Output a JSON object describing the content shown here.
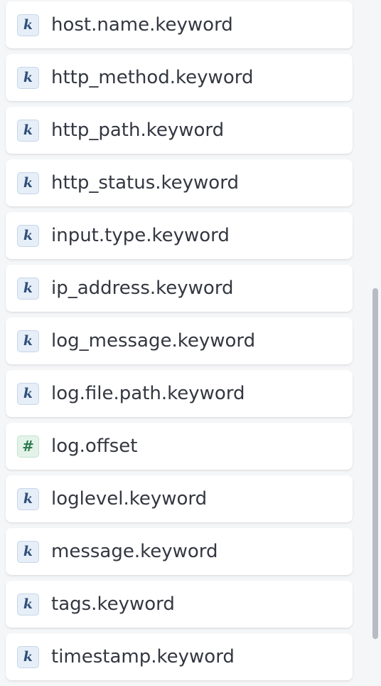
{
  "field_list": {
    "items": [
      {
        "type": "keyword",
        "badge": "k",
        "label": "host.name.keyword"
      },
      {
        "type": "keyword",
        "badge": "k",
        "label": "http_method.keyword"
      },
      {
        "type": "keyword",
        "badge": "k",
        "label": "http_path.keyword"
      },
      {
        "type": "keyword",
        "badge": "k",
        "label": "http_status.keyword"
      },
      {
        "type": "keyword",
        "badge": "k",
        "label": "input.type.keyword"
      },
      {
        "type": "keyword",
        "badge": "k",
        "label": "ip_address.keyword"
      },
      {
        "type": "keyword",
        "badge": "k",
        "label": "log_message.keyword"
      },
      {
        "type": "keyword",
        "badge": "k",
        "label": "log.file.path.keyword"
      },
      {
        "type": "number",
        "badge": "#",
        "label": "log.offset"
      },
      {
        "type": "keyword",
        "badge": "k",
        "label": "loglevel.keyword"
      },
      {
        "type": "keyword",
        "badge": "k",
        "label": "message.keyword"
      },
      {
        "type": "keyword",
        "badge": "k",
        "label": "tags.keyword"
      },
      {
        "type": "keyword",
        "badge": "k",
        "label": "timestamp.keyword"
      }
    ]
  },
  "colors": {
    "keyword_badge": "#2f4f7a",
    "number_badge": "#2e7a4f",
    "text": "#343741",
    "background": "#f5f6f8"
  },
  "icons": {
    "keyword": "keyword-type-icon",
    "number": "number-type-icon"
  }
}
